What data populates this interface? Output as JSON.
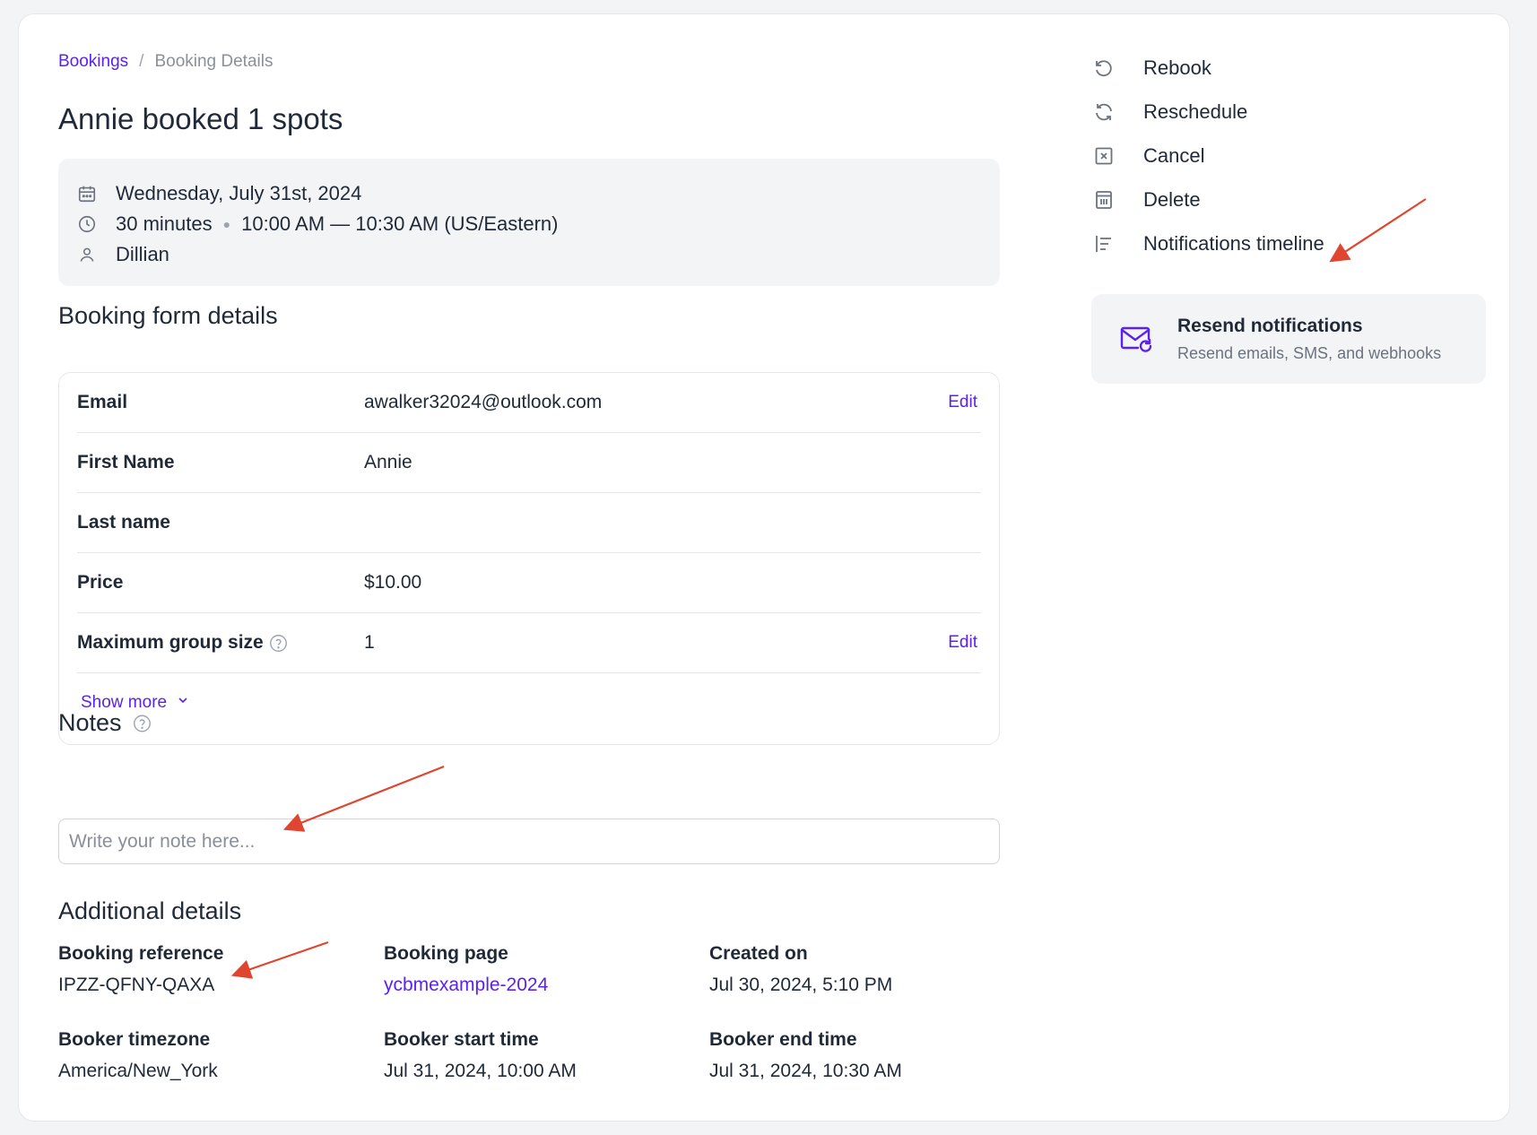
{
  "breadcrumb": {
    "root": "Bookings",
    "separator": "/",
    "current": "Booking Details"
  },
  "page_title": "Annie booked 1 spots",
  "summary": {
    "date": "Wednesday, July 31st, 2024",
    "duration": "30 minutes",
    "time_range": "10:00 AM — 10:30 AM (US/Eastern)",
    "person": "Dillian",
    "icons": [
      "calendar-icon",
      "clock-icon",
      "user-icon"
    ]
  },
  "form_section": {
    "title": "Booking form details",
    "rows": [
      {
        "label": "Email",
        "value": "awalker32024@outlook.com",
        "edit": "Edit"
      },
      {
        "label": "First Name",
        "value": "Annie",
        "edit": ""
      },
      {
        "label": "Last name",
        "value": "",
        "edit": ""
      },
      {
        "label": "Price",
        "value": "$10.00",
        "edit": ""
      },
      {
        "label": "Maximum group size",
        "value": "1",
        "edit": "Edit"
      }
    ],
    "show_more": "Show more"
  },
  "notes": {
    "title": "Notes",
    "placeholder": "Write your note here..."
  },
  "additional": {
    "title": "Additional details",
    "items": [
      {
        "label": "Booking reference",
        "value": "IPZZ-QFNY-QAXA"
      },
      {
        "label": "Booking page",
        "value": "ycbmexample-2024"
      },
      {
        "label": "Created on",
        "value": "Jul 30, 2024, 5:10 PM"
      },
      {
        "label": "Booker timezone",
        "value": "America/New_York"
      },
      {
        "label": "Booker start time",
        "value": "Jul 31, 2024, 10:00 AM"
      },
      {
        "label": "Booker end time",
        "value": "Jul 31, 2024, 10:30 AM"
      }
    ]
  },
  "side_actions": [
    {
      "label": "Rebook",
      "icon": "rebook-icon"
    },
    {
      "label": "Reschedule",
      "icon": "reschedule-icon"
    },
    {
      "label": "Cancel",
      "icon": "cancel-icon"
    },
    {
      "label": "Delete",
      "icon": "trash-icon"
    },
    {
      "label": "Notifications timeline",
      "icon": "timeline-icon"
    }
  ],
  "resend": {
    "title": "Resend notifications",
    "subtitle": "Resend emails, SMS, and webhooks",
    "icon": "mail-resend-icon"
  },
  "colors": {
    "accent": "#5b21f0",
    "annotation": "#e0452f",
    "panel": "#f3f4f6"
  }
}
